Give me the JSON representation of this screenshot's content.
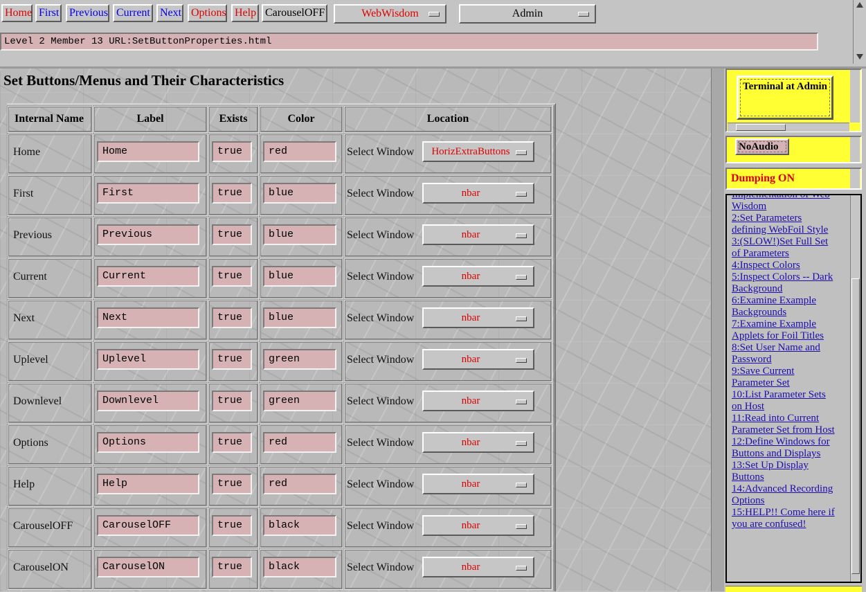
{
  "nav": {
    "buttons": [
      {
        "label": "Home",
        "color": "#e00000"
      },
      {
        "label": "First",
        "color": "#0000ee"
      },
      {
        "label": "Previous",
        "color": "#0000ee"
      },
      {
        "label": "Current",
        "color": "#0000ee"
      },
      {
        "label": "Next",
        "color": "#0000ee"
      },
      {
        "label": "Options",
        "color": "#e00000"
      },
      {
        "label": "Help",
        "color": "#e00000"
      },
      {
        "label": "CarouselOFF",
        "color": "#000000"
      }
    ],
    "style_select": "WebWisdom",
    "user_select": "Admin"
  },
  "status": {
    "url_line": "Level 2 Member 13 URL:SetButtonProperties.html"
  },
  "page": {
    "title": "Set Buttons/Menus and Their Characteristics",
    "columns": [
      "Internal Name",
      "Label",
      "Exists",
      "Color",
      "Location"
    ],
    "select_window_label": "Select Window",
    "rows": [
      {
        "name": "Home",
        "label": "Home",
        "exists": "true",
        "color": "red",
        "location": "HorizExtraButtons"
      },
      {
        "name": "First",
        "label": "First",
        "exists": "true",
        "color": "blue",
        "location": "nbar"
      },
      {
        "name": "Previous",
        "label": "Previous",
        "exists": "true",
        "color": "blue",
        "location": "nbar"
      },
      {
        "name": "Current",
        "label": "Current",
        "exists": "true",
        "color": "blue",
        "location": "nbar"
      },
      {
        "name": "Next",
        "label": "Next",
        "exists": "true",
        "color": "blue",
        "location": "nbar"
      },
      {
        "name": "Uplevel",
        "label": "Uplevel",
        "exists": "true",
        "color": "green",
        "location": "nbar"
      },
      {
        "name": "Downlevel",
        "label": "Downlevel",
        "exists": "true",
        "color": "green",
        "location": "nbar"
      },
      {
        "name": "Options",
        "label": "Options",
        "exists": "true",
        "color": "red",
        "location": "nbar"
      },
      {
        "name": "Help",
        "label": "Help",
        "exists": "true",
        "color": "red",
        "location": "nbar"
      },
      {
        "name": "CarouselOFF",
        "label": "CarouselOFF",
        "exists": "true",
        "color": "black",
        "location": "nbar"
      },
      {
        "name": "CarouselON",
        "label": "CarouselON",
        "exists": "true",
        "color": "black",
        "location": "nbar"
      }
    ]
  },
  "side": {
    "terminal_label": "Terminal at Admin",
    "audio_button": "NoAudio",
    "dumping_status": "Dumping ON",
    "links": [
      "Implementation of Web Wisdom",
      "2:Set Parameters defining WebFoil Style",
      "3:(SLOW!)Set Full Set of Parameters",
      "4:Inspect Colors",
      "5:Inspect Colors -- Dark Background",
      "6:Examine Example Backgrounds",
      "7:Examine Example Applets for Foil Titles",
      "8:Set User Name and Password",
      "9:Save Current Parameter Set",
      "10:List Parameter Sets on Host",
      "11:Read into Current Parameter Set from Host",
      "12:Define Windows for Buttons and Displays",
      "13:Set Up Display Buttons",
      "14:Advanced Recording Options",
      "15:HELP!! Come here if you are confused!"
    ]
  },
  "colors": {
    "background": "#c0c0c0",
    "field_pink": "#d6b2b4",
    "highlight_yellow": "#ffff33",
    "red_text": "#e00000",
    "link": "#1a0dab"
  }
}
